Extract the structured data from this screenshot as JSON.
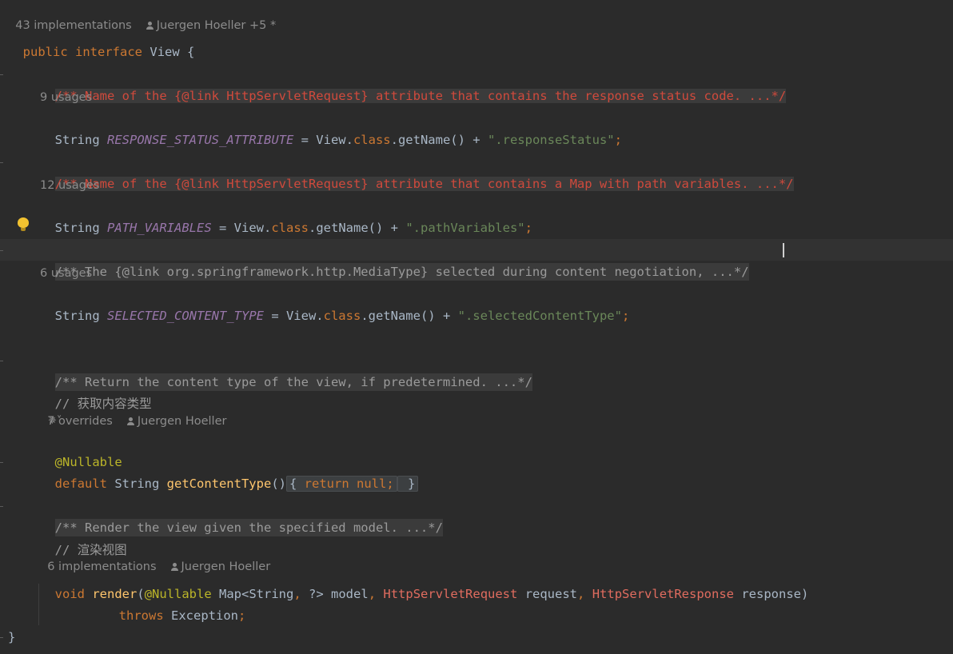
{
  "header_hint": {
    "implementations": "43 implementations",
    "author": "Juergen Hoeller +5 *"
  },
  "decl": {
    "public": "public",
    "interface": "interface",
    "name": "View {"
  },
  "status_attr": {
    "doc": "/** Name of the {@link HttpServletRequest} attribute that contains the response status code. ...*/",
    "usages": "9 usages",
    "type": "String",
    "const": "RESPONSE_STATUS_ATTRIBUTE",
    "eq": " = View.",
    "cls": "class",
    "getname": ".getName() + ",
    "str": "\".responseStatus\"",
    "semi": ";"
  },
  "path_vars": {
    "doc": "/** Name of the {@link HttpServletRequest} attribute that contains a Map with path variables. ...*/",
    "usages": "12 usages",
    "type": "String",
    "const": "PATH_VARIABLES",
    "eq": " = View.",
    "cls": "class",
    "getname": ".getName() + ",
    "str": "\".pathVariables\"",
    "semi": ";"
  },
  "content_type": {
    "doc": "/** The {@link org.springframework.http.MediaType} selected during content negotiation, ...*/",
    "usages": "6 usages",
    "type": "String",
    "const": "SELECTED_CONTENT_TYPE",
    "eq": " = View.",
    "cls": "class",
    "getname": ".getName() + ",
    "str": "\".selectedContentType\"",
    "semi": ";"
  },
  "get_content_type": {
    "doc": "/** Return the content type of the view, if predetermined. ...*/",
    "comment": "// 获取内容类型",
    "overrides": "7 overrides",
    "author": "Juergen Hoeller",
    "ai_icon": "✵˅",
    "annotation": "@Nullable",
    "default": "default",
    "type": " String ",
    "fn": "getContentType",
    "parens": "()",
    "body_open": "{ ",
    "return": "return",
    "null": " null",
    "body_semi": ";",
    "body_close": " }"
  },
  "render": {
    "doc": "/** Render the view given the specified model. ...*/",
    "comment": "// 渲染视图",
    "implementations": "6 implementations",
    "author": "Juergen Hoeller",
    "void": "void",
    "fn": "render",
    "open": "(",
    "ann": "@Nullable",
    "map": " Map<String",
    "comma1": ",",
    "wild": " ?> model",
    "comma2": ",",
    "req_type": "HttpServletRequest",
    "req": " request",
    "comma3": ",",
    "resp_type": "HttpServletResponse",
    "resp": " response)",
    "throws": "throws",
    "exception": " Exception",
    "semi": ";"
  },
  "closing_brace": "}",
  "colors": {
    "background": "#2b2b2b",
    "keyword": "#cc7832",
    "string": "#6a8759",
    "constant": "#9876aa",
    "function": "#ffc66d",
    "annotation": "#bbb529",
    "error_doc": "#d04a3c"
  }
}
